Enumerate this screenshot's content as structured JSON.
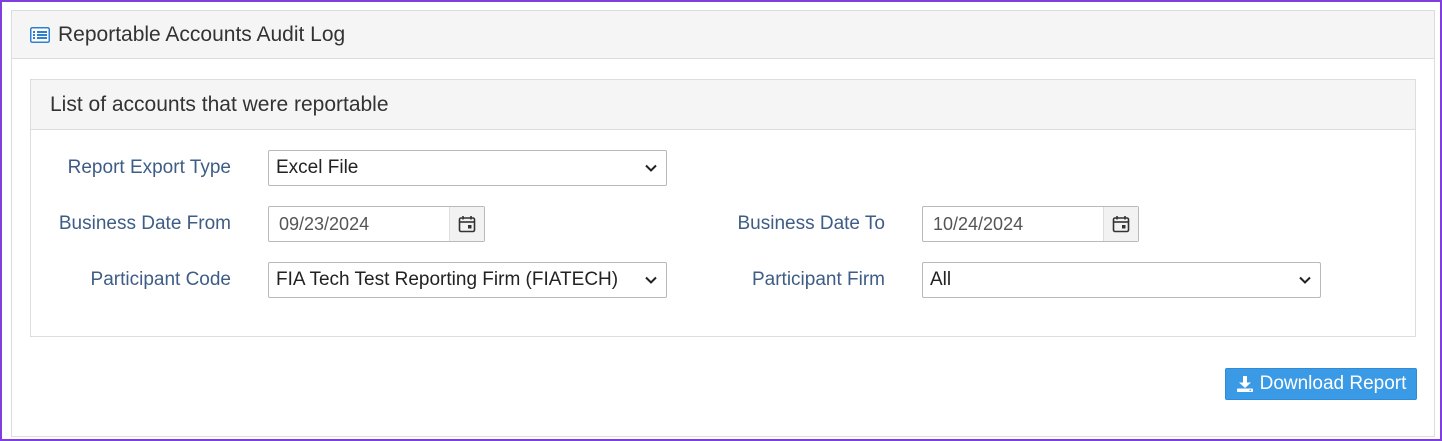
{
  "header": {
    "title": "Reportable Accounts Audit Log",
    "icon": "list-icon"
  },
  "section": {
    "title": "List of accounts that were reportable"
  },
  "form": {
    "report_export_type": {
      "label": "Report Export Type",
      "value": "Excel File"
    },
    "business_date_from": {
      "label": "Business Date From",
      "value": "09/23/2024"
    },
    "business_date_to": {
      "label": "Business Date To",
      "value": "10/24/2024"
    },
    "participant_code": {
      "label": "Participant Code",
      "value": "FIA Tech Test Reporting Firm (FIATECH)"
    },
    "participant_firm": {
      "label": "Participant Firm",
      "value": "All"
    }
  },
  "actions": {
    "download_label": "Download Report",
    "download_icon": "download-icon"
  },
  "colors": {
    "accent": "#3a9ae6",
    "label": "#3e5d86",
    "window_border": "#7f3fe0",
    "icon": "#2f7fd1"
  }
}
